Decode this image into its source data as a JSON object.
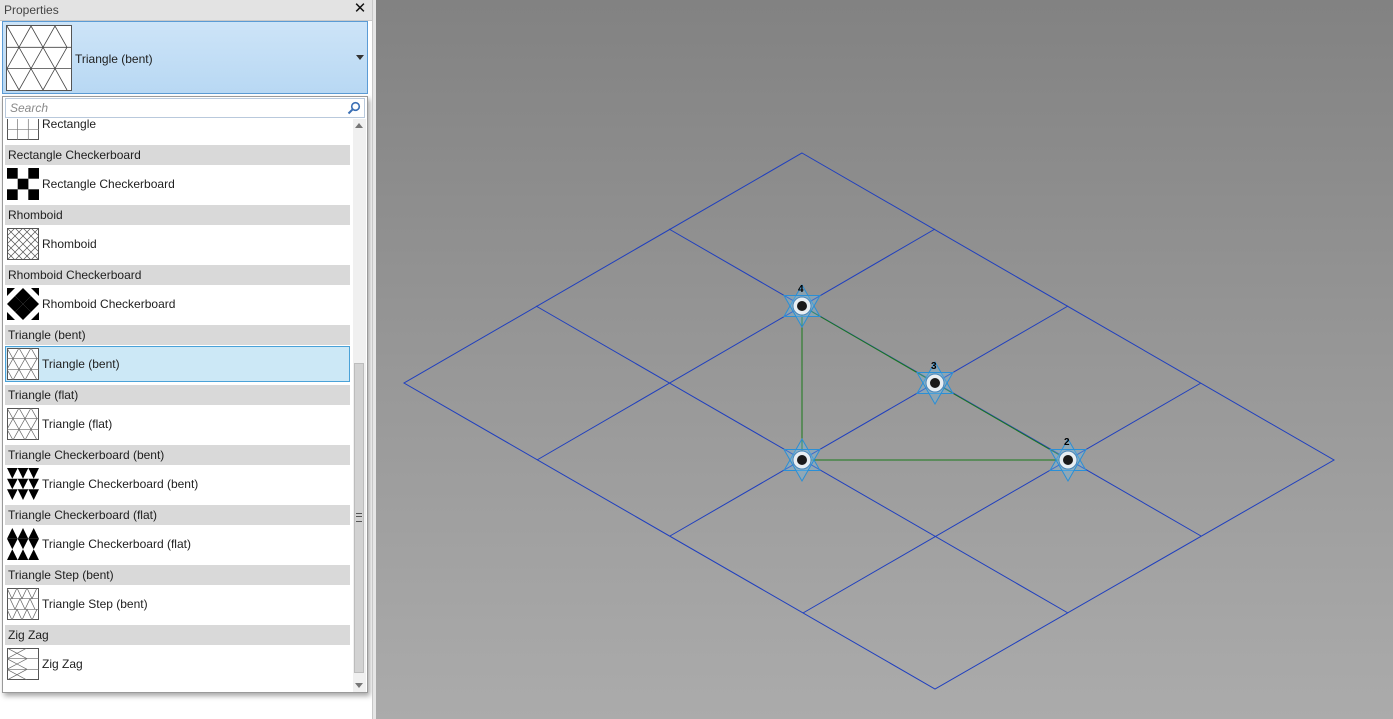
{
  "panel": {
    "title": "Properties",
    "close_icon": "close-icon",
    "type_selector": {
      "label": "Triangle (bent)",
      "icon": "triangle-bent-pattern-icon"
    },
    "search": {
      "placeholder": "Search",
      "icon": "search-icon"
    },
    "partial_item": {
      "label": "Rectangle",
      "icon": "rectangle-pattern-icon"
    },
    "groups": [
      {
        "header": "Rectangle Checkerboard",
        "item": "Rectangle Checkerboard",
        "icon": "rectangle-checkerboard-icon",
        "selected": false
      },
      {
        "header": "Rhomboid",
        "item": "Rhomboid",
        "icon": "rhomboid-icon",
        "selected": false
      },
      {
        "header": "Rhomboid Checkerboard",
        "item": "Rhomboid Checkerboard",
        "icon": "rhomboid-checkerboard-icon",
        "selected": false
      },
      {
        "header": "Triangle (bent)",
        "item": "Triangle (bent)",
        "icon": "triangle-bent-icon",
        "selected": true
      },
      {
        "header": "Triangle (flat)",
        "item": "Triangle (flat)",
        "icon": "triangle-flat-icon",
        "selected": false
      },
      {
        "header": "Triangle Checkerboard (bent)",
        "item": "Triangle Checkerboard (bent)",
        "icon": "triangle-checkerboard-bent-icon",
        "selected": false
      },
      {
        "header": "Triangle Checkerboard (flat)",
        "item": "Triangle Checkerboard (flat)",
        "icon": "triangle-checkerboard-flat-icon",
        "selected": false
      },
      {
        "header": "Triangle Step (bent)",
        "item": "Triangle Step (bent)",
        "icon": "triangle-step-bent-icon",
        "selected": false
      },
      {
        "header": "Zig Zag",
        "item": "Zig Zag",
        "icon": "zig-zag-icon",
        "selected": false
      }
    ]
  },
  "canvas": {
    "points": [
      {
        "label": "4"
      },
      {
        "label": "3"
      },
      {
        "label": "2"
      },
      {
        "label": ""
      }
    ]
  },
  "colors": {
    "selection_fill": "#cce8f6",
    "selection_border": "#4aa2d8",
    "grid_line": "#1f3fbf",
    "triangle_line": "#1a7a1a",
    "node_marker": "#2a8fd6"
  }
}
